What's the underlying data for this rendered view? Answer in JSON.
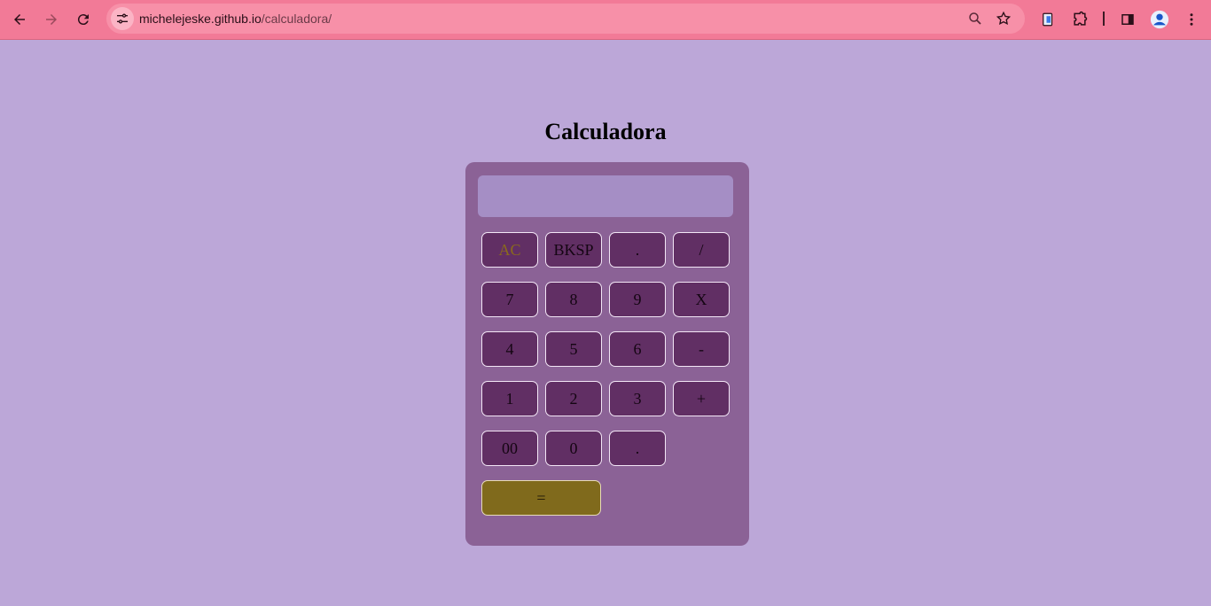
{
  "browser": {
    "url_host": "michelejeske.github.io",
    "url_path": "/calculadora/"
  },
  "page": {
    "title": "Calculadora",
    "display_value": ""
  },
  "keys": {
    "row1": [
      "AC",
      "BKSP",
      ".",
      "/"
    ],
    "row2": [
      "7",
      "8",
      "9",
      "X"
    ],
    "row3": [
      "4",
      "5",
      "6",
      "-"
    ],
    "row4": [
      "1",
      "2",
      "3",
      "+"
    ],
    "row5": [
      "00",
      "0",
      "."
    ],
    "equals": "="
  },
  "colors": {
    "page_background": "#bca7d8",
    "browser_bar": "#f27a97",
    "calculator_body": "#8b6296",
    "display": "#a58ec5",
    "key": "#612f64",
    "equals_key": "#806a1c",
    "ac_text": "#8a6a1c"
  },
  "icons": {
    "back": "arrow-left-icon",
    "forward": "arrow-right-icon",
    "reload": "reload-icon",
    "site_info": "tune-icon",
    "zoom": "zoom-icon",
    "bookmark": "star-icon",
    "extension_a": "document-icon",
    "extensions": "puzzle-icon",
    "side_panel": "side-panel-icon",
    "profile": "profile-icon",
    "menu": "kebab-menu-icon"
  }
}
